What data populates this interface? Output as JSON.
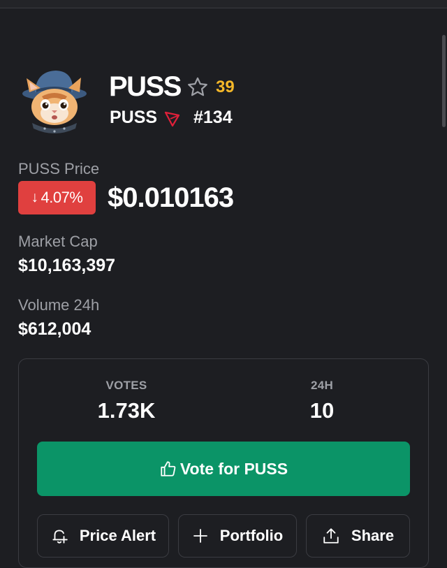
{
  "coin": {
    "name": "PUSS",
    "watchers": "39",
    "symbol": "PUSS",
    "rank": "#134",
    "avatar_icon": "cat-wizard-hat-logo",
    "chain_icon": "tron-icon",
    "chain_color": "#e0203a"
  },
  "price": {
    "label": "PUSS Price",
    "change": "4.07%",
    "change_direction": "down",
    "value": "$0.010163"
  },
  "stats": {
    "market_cap_label": "Market Cap",
    "market_cap_value": "$10,163,397",
    "volume_label": "Volume 24h",
    "volume_value": "$612,004"
  },
  "votes": {
    "votes_label": "VOTES",
    "votes_value": "1.73K",
    "day_label": "24H",
    "day_value": "10",
    "vote_button_label": "Vote for PUSS"
  },
  "actions": [
    {
      "label": "Price Alert",
      "icon": "bell-plus-icon"
    },
    {
      "label": "Portfolio",
      "icon": "plus-icon"
    },
    {
      "label": "Share",
      "icon": "share-upload-icon"
    }
  ],
  "colors": {
    "background": "#1d1e22",
    "accent_green": "#0b9467",
    "negative_red": "#e0403f",
    "watch_gold": "#f5b829",
    "muted_text": "#9ea0a6"
  }
}
